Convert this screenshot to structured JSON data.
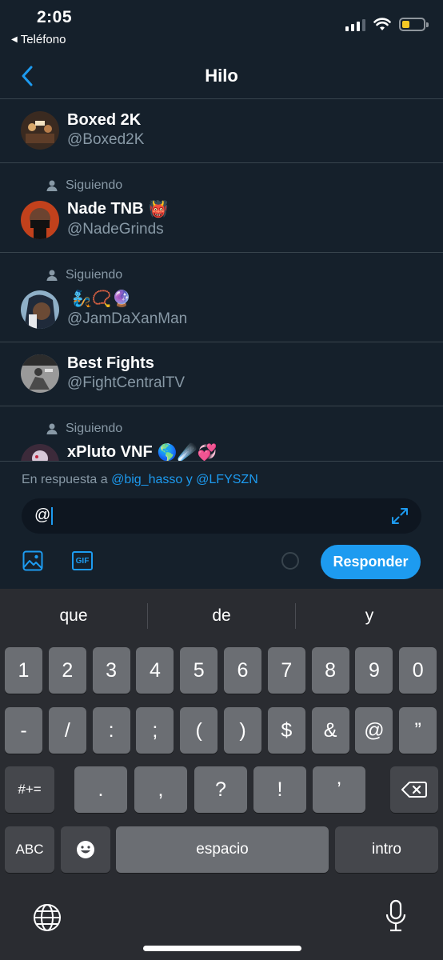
{
  "status_bar": {
    "time": "2:05",
    "back_app": "Teléfono",
    "battery_color": "#f5c825"
  },
  "nav": {
    "title": "Hilo",
    "back_icon": "chevron-left-icon"
  },
  "users": [
    {
      "name": "Boxed 2K",
      "handle": "@Boxed2K",
      "following": false,
      "name_emoji": ""
    },
    {
      "name": "Nade TNB",
      "handle": "@NadeGrinds",
      "following": true,
      "following_label": "Siguiendo",
      "name_emoji": "👹"
    },
    {
      "name": "",
      "handle": "@JamDaXanMan",
      "following": true,
      "following_label": "Siguiendo",
      "name_emoji": "🧞📿🔮"
    },
    {
      "name": "Best Fights",
      "handle": "@FightCentralTV",
      "following": false,
      "name_emoji": ""
    },
    {
      "name": "xPluto VNF",
      "handle": "",
      "following": true,
      "following_label": "Siguiendo",
      "name_emoji": "🌎☄️💞"
    }
  ],
  "reply": {
    "prefix": "En respuesta a ",
    "mention_1": "@big_hasso",
    "connector": " y ",
    "mention_2": "@LFYSZN",
    "compose_value": "@",
    "gif_label": "GIF",
    "button_label": "Responder",
    "accent": "#1d9bf0"
  },
  "keyboard": {
    "suggestions": [
      "que",
      "de",
      "y"
    ],
    "row1": [
      "1",
      "2",
      "3",
      "4",
      "5",
      "6",
      "7",
      "8",
      "9",
      "0"
    ],
    "row2": [
      "-",
      "/",
      ":",
      ";",
      "(",
      ")",
      "$",
      "&",
      "@",
      "”"
    ],
    "row3_left": "#+=",
    "row3": [
      ".",
      ",",
      "?",
      "!",
      "’"
    ],
    "abc": "ABC",
    "space": "espacio",
    "return": "intro"
  }
}
